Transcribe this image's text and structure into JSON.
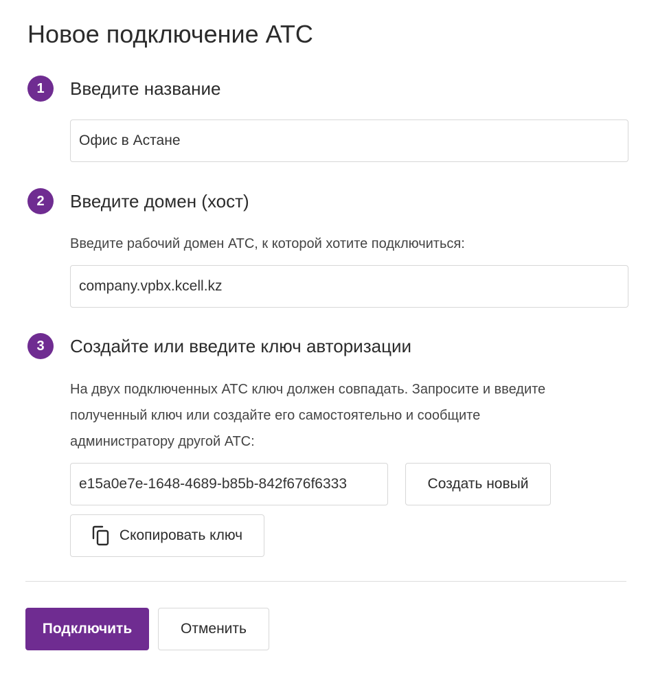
{
  "page": {
    "title": "Новое подключение АТС"
  },
  "steps": [
    {
      "number": "1",
      "title": "Введите название",
      "input_value": "Офис в Астане"
    },
    {
      "number": "2",
      "title": "Введите домен (хост)",
      "description": "Введите рабочий домен АТС, к которой хотите подключиться:",
      "input_value": "company.vpbx.kcell.kz"
    },
    {
      "number": "3",
      "title": "Создайте или введите ключ авторизации",
      "description_lines": [
        "На двух подключенных АТС ключ должен совпадать. Запросите и введите",
        "полученный ключ или создайте его самостоятельно и сообщите",
        "администратору другой АТС:"
      ],
      "key_value": "e15a0e7e-1648-4689-b85b-842f676f6333",
      "create_new_label": "Создать новый",
      "copy_key_label": "Скопировать ключ",
      "copy_icon": "copy-icon"
    }
  ],
  "actions": {
    "connect_label": "Подключить",
    "cancel_label": "Отменить"
  },
  "colors": {
    "accent": "#6f2c91",
    "border": "#d7d7d7",
    "text": "#333333"
  }
}
